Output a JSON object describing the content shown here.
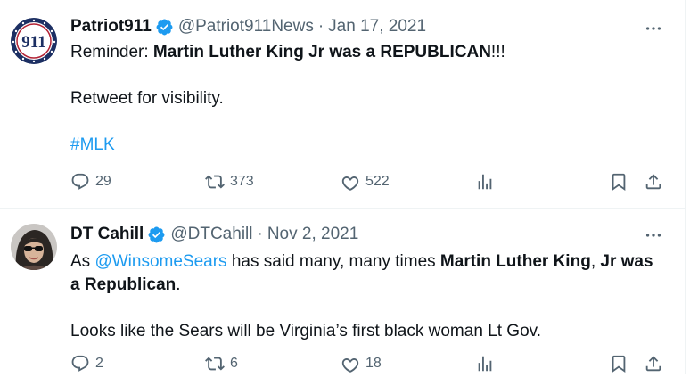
{
  "tweets": [
    {
      "name": "Patriot911",
      "handle": "@Patriot911News",
      "dot": "·",
      "date": "Jan 17, 2021",
      "avatar_label": "911",
      "line1_prefix": "Reminder: ",
      "line1_bold": "Martin Luther King Jr was a REPUBLICAN",
      "line1_suffix": "!!!",
      "line2": "Retweet for visibility.",
      "hashtag": "#MLK",
      "replies": "29",
      "retweets": "373",
      "likes": "522"
    },
    {
      "name": "DT Cahill",
      "handle": "@DTCahill",
      "dot": "·",
      "date": "Nov 2, 2021",
      "p1_a": "As ",
      "p1_mention": "@WinsomeSears",
      "p1_b": " has said many, many times ",
      "p1_bold1": "Martin Luther King",
      "p1_c": ", ",
      "p1_bold2": "Jr was a Republican",
      "p1_d": ".",
      "p2": "Looks like the Sears will be Virginia’s first black woman Lt Gov.",
      "replies": "2",
      "retweets": "6",
      "likes": "18"
    }
  ],
  "colors": {
    "accent": "#1d9bf0",
    "muted": "#536471",
    "text": "#0f1419",
    "border": "#eff3f4"
  },
  "icons": [
    "more-icon",
    "verified-badge-icon",
    "reply-icon",
    "retweet-icon",
    "like-icon",
    "views-icon",
    "bookmark-icon",
    "share-icon"
  ]
}
